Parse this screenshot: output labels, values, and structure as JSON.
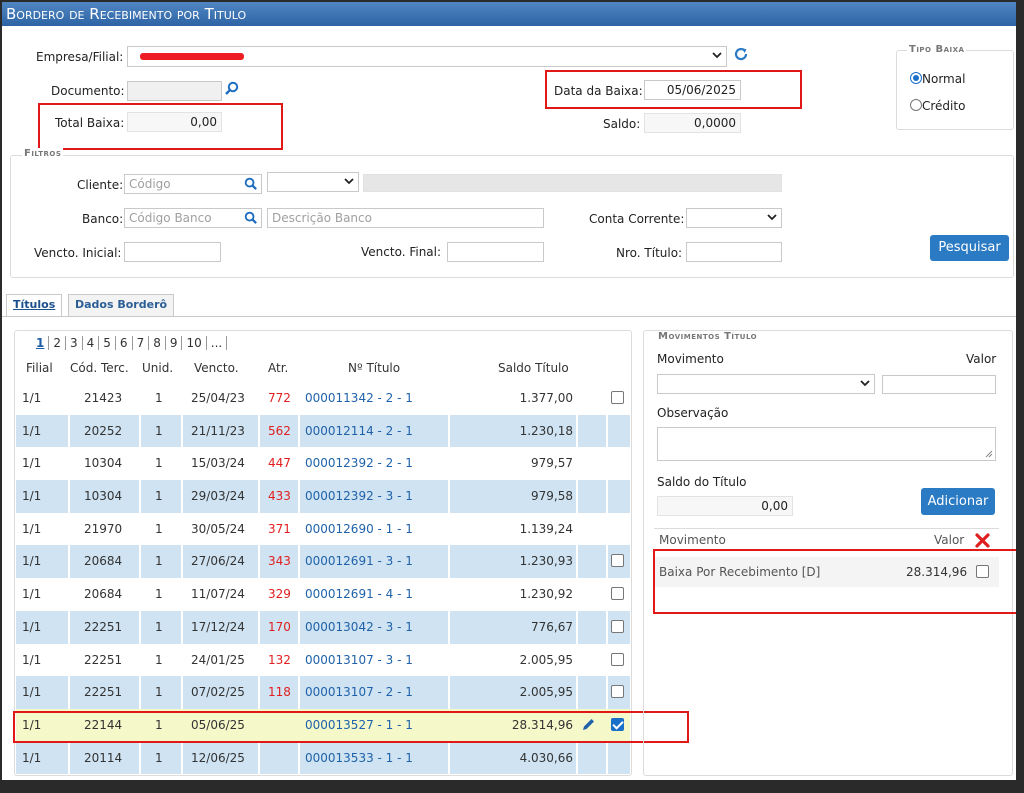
{
  "window": {
    "title": "Bordero de Recebimento por Titulo"
  },
  "header": {
    "empresa_label": "Empresa/Filial:",
    "documento_label": "Documento:",
    "total_baixa_label": "Total Baixa:",
    "total_baixa_value": "0,00",
    "data_baixa_label": "Data da Baixa:",
    "data_baixa_value": "05/06/2025",
    "saldo_label": "Saldo:",
    "saldo_value": "0,0000"
  },
  "tipo_baixa": {
    "legend": "Tipo Baixa",
    "options": [
      {
        "label": "Normal",
        "selected": true
      },
      {
        "label": "Crédito",
        "selected": false
      }
    ]
  },
  "filtros": {
    "legend": "Filtros",
    "cliente_label": "Cliente:",
    "cliente_placeholder": "Código",
    "banco_label": "Banco:",
    "banco_codigo_placeholder": "Código Banco",
    "banco_descricao_placeholder": "Descrição Banco",
    "conta_corrente_label": "Conta Corrente:",
    "vencto_inicial_label": "Vencto. Inicial:",
    "vencto_final_label": "Vencto. Final:",
    "nro_titulo_label": "Nro. Título:",
    "pesquisar_label": "Pesquisar"
  },
  "tabs": [
    {
      "label": "Títulos",
      "active": true
    },
    {
      "label": "Dados Borderô",
      "active": false
    }
  ],
  "pagination": [
    "1",
    "2",
    "3",
    "4",
    "5",
    "6",
    "7",
    "8",
    "9",
    "10",
    "..."
  ],
  "table": {
    "columns": [
      "Filial",
      "Cód. Terc.",
      "Unid.",
      "Vencto.",
      "Atr.",
      "Nº Título",
      "Saldo Título"
    ],
    "rows": [
      {
        "filial": "1/1",
        "cod": "21423",
        "unid": "1",
        "vencto": "25/04/23",
        "atr": "772",
        "titulo": "000011342 - 2 - 1",
        "saldo": "1.377,00",
        "checkbox": true,
        "checked": false,
        "edit": false
      },
      {
        "filial": "1/1",
        "cod": "20252",
        "unid": "1",
        "vencto": "21/11/23",
        "atr": "562",
        "titulo": "000012114 - 2 - 1",
        "saldo": "1.230,18",
        "checkbox": false,
        "checked": false,
        "edit": false
      },
      {
        "filial": "1/1",
        "cod": "10304",
        "unid": "1",
        "vencto": "15/03/24",
        "atr": "447",
        "titulo": "000012392 - 2 - 1",
        "saldo": "979,57",
        "checkbox": false,
        "checked": false,
        "edit": false
      },
      {
        "filial": "1/1",
        "cod": "10304",
        "unid": "1",
        "vencto": "29/03/24",
        "atr": "433",
        "titulo": "000012392 - 3 - 1",
        "saldo": "979,58",
        "checkbox": false,
        "checked": false,
        "edit": false
      },
      {
        "filial": "1/1",
        "cod": "21970",
        "unid": "1",
        "vencto": "30/05/24",
        "atr": "371",
        "titulo": "000012690 - 1 - 1",
        "saldo": "1.139,24",
        "checkbox": false,
        "checked": false,
        "edit": false
      },
      {
        "filial": "1/1",
        "cod": "20684",
        "unid": "1",
        "vencto": "27/06/24",
        "atr": "343",
        "titulo": "000012691 - 3 - 1",
        "saldo": "1.230,93",
        "checkbox": true,
        "checked": false,
        "edit": false
      },
      {
        "filial": "1/1",
        "cod": "20684",
        "unid": "1",
        "vencto": "11/07/24",
        "atr": "329",
        "titulo": "000012691 - 4 - 1",
        "saldo": "1.230,92",
        "checkbox": true,
        "checked": false,
        "edit": false
      },
      {
        "filial": "1/1",
        "cod": "22251",
        "unid": "1",
        "vencto": "17/12/24",
        "atr": "170",
        "titulo": "000013042 - 3 - 1",
        "saldo": "776,67",
        "checkbox": true,
        "checked": false,
        "edit": false
      },
      {
        "filial": "1/1",
        "cod": "22251",
        "unid": "1",
        "vencto": "24/01/25",
        "atr": "132",
        "titulo": "000013107 - 3 - 1",
        "saldo": "2.005,95",
        "checkbox": true,
        "checked": false,
        "edit": false
      },
      {
        "filial": "1/1",
        "cod": "22251",
        "unid": "1",
        "vencto": "07/02/25",
        "atr": "118",
        "titulo": "000013107 - 2 - 1",
        "saldo": "2.005,95",
        "checkbox": true,
        "checked": false,
        "edit": false
      },
      {
        "filial": "1/1",
        "cod": "22144",
        "unid": "1",
        "vencto": "05/06/25",
        "atr": "",
        "titulo": "000013527 - 1 - 1",
        "saldo": "28.314,96",
        "checkbox": true,
        "checked": true,
        "edit": true
      },
      {
        "filial": "1/1",
        "cod": "20114",
        "unid": "1",
        "vencto": "12/06/25",
        "atr": "",
        "titulo": "000013533 - 1 - 1",
        "saldo": "4.030,66",
        "checkbox": false,
        "checked": false,
        "edit": false
      }
    ]
  },
  "movimentos": {
    "legend": "Movimentos Título",
    "movimento_label": "Movimento",
    "valor_label": "Valor",
    "observacao_label": "Observação",
    "saldo_titulo_label": "Saldo do Título",
    "saldo_titulo_value": "0,00",
    "adicionar_label": "Adicionar",
    "list_header_movimento": "Movimento",
    "list_header_valor": "Valor",
    "items": [
      {
        "movimento": "Baixa Por Recebimento [D]",
        "valor": "28.314,96"
      }
    ]
  },
  "colors": {
    "titlebar": "#3a72b3",
    "alt_row": "#cfe3f2",
    "highlight_row": "#f5f8c9",
    "atraso": "#e02020",
    "link": "#1f62aa",
    "button": "#2a7ac4",
    "annotation_red": "#e01818"
  }
}
